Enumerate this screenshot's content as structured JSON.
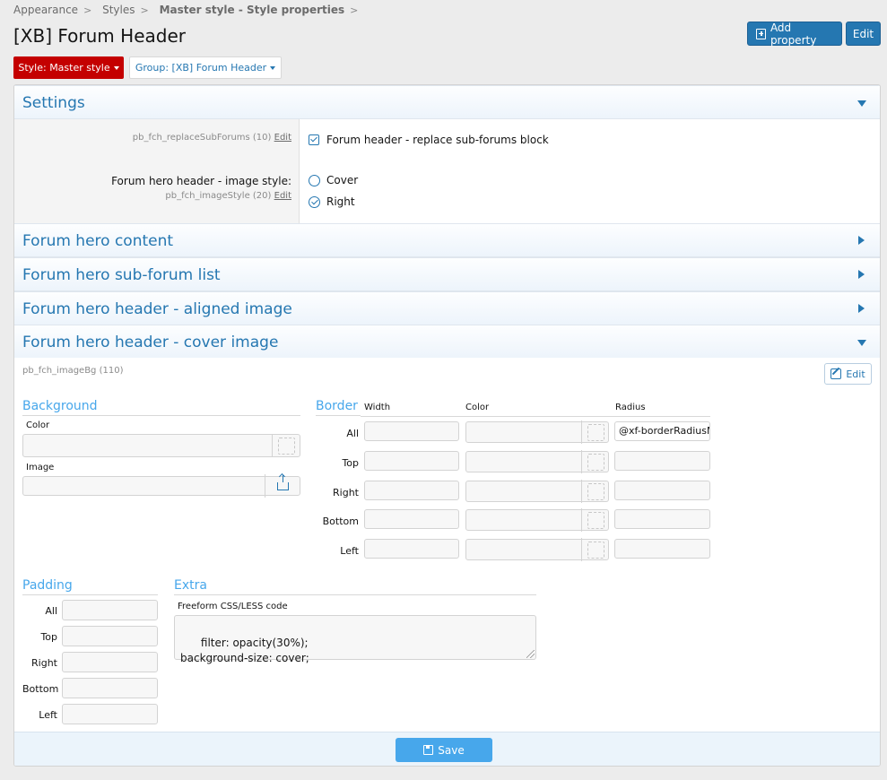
{
  "breadcrumb": {
    "items": [
      "Appearance",
      "Styles",
      "Master style - Style properties"
    ],
    "separator": ">"
  },
  "header": {
    "title": "[XB] Forum Header",
    "add_property_label": "Add property",
    "edit_label": "Edit"
  },
  "filters": {
    "style_label": "Style: Master style",
    "group_label": "Group: [XB] Forum Header"
  },
  "sections": {
    "settings": "Settings",
    "hero_content": "Forum hero content",
    "subforum_list": "Forum hero sub-forum list",
    "aligned_image": "Forum hero header - aligned image",
    "cover_image": "Forum hero header - cover image"
  },
  "settings": {
    "replace_key": "pb_fch_replaceSubForums (10)",
    "edit_link": "Edit",
    "replace_label": "Forum header - replace sub-forums block",
    "image_style_label": "Forum hero header - image style:",
    "image_style_key": "pb_fch_imageStyle (20)",
    "options": [
      "Cover",
      "Right"
    ],
    "selected_option": "Right"
  },
  "cover": {
    "prop_key": "pb_fch_imageBg (110)",
    "edit_label": "Edit",
    "background": {
      "title": "Background",
      "color_label": "Color",
      "image_label": "Image"
    },
    "border": {
      "title": "Border",
      "col_width": "Width",
      "col_color": "Color",
      "col_radius": "Radius",
      "rows": [
        "All",
        "Top",
        "Right",
        "Bottom",
        "Left"
      ],
      "radius_all_value": "@xf-borderRadiusM"
    },
    "padding": {
      "title": "Padding",
      "rows": [
        "All",
        "Top",
        "Right",
        "Bottom",
        "Left"
      ]
    },
    "extra": {
      "title": "Extra",
      "code_label": "Freeform CSS/LESS code",
      "code_value": "filter: opacity(30%);\nbackground-size: cover;"
    }
  },
  "footer": {
    "save_label": "Save"
  },
  "colors": {
    "accent": "#2577b1",
    "style_button": "#c40000",
    "save_button": "#47a7eb"
  }
}
